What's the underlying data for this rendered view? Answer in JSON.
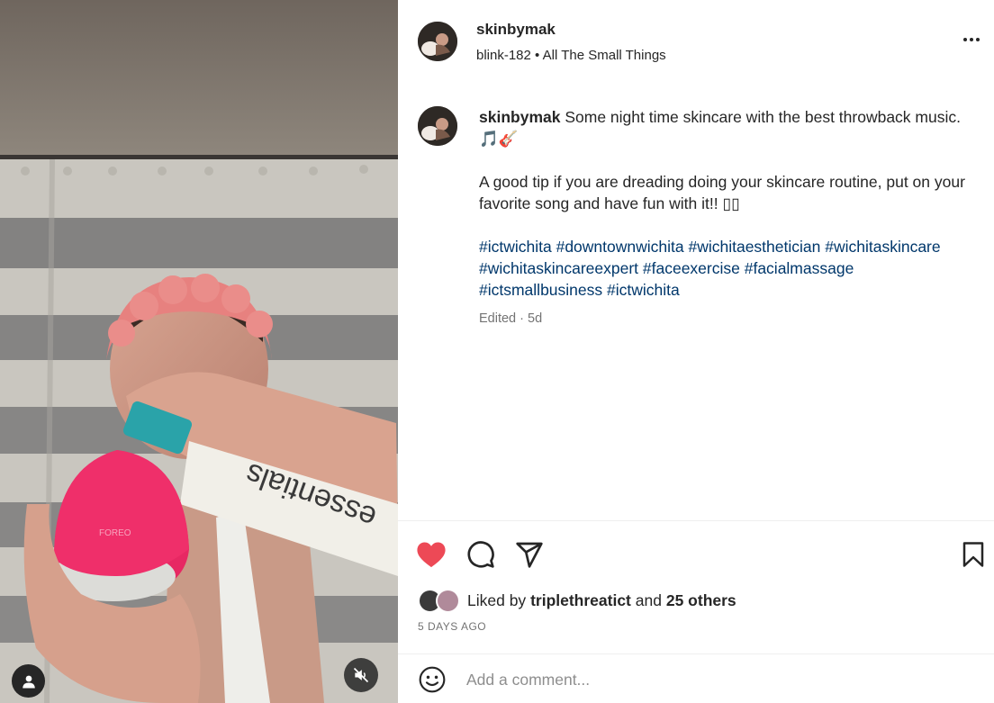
{
  "post": {
    "username": "skinbymak",
    "audio": {
      "artist": "blink-182",
      "separator": "•",
      "track": "All The Small Things"
    }
  },
  "caption": {
    "username": "skinbymak",
    "text": "Some night time skincare with the best throwback music. 🎵🎸",
    "tip": "A good tip if you are dreading doing your skincare routine, put on your favorite song and have fun with it!! ▯▯",
    "hashtags": "#ictwichita #downtownwichita #wichitaesthetician #wichitaskincare #wichitaskincareexpert #faceexercise #facialmassage #ictsmallbusiness #ictwichita",
    "meta": "Edited · 5d"
  },
  "likes": {
    "prefix": "Liked by",
    "user": "triplethreatict",
    "middle": "and",
    "others": "25 others"
  },
  "date": "5 DAYS AGO",
  "comment": {
    "placeholder": "Add a comment..."
  },
  "media": {
    "product_text": "essentials"
  },
  "icons": {
    "like": "heart-filled-icon",
    "comment": "comment-bubble-icon",
    "share": "paper-plane-icon",
    "save": "bookmark-icon",
    "more": "more-options-icon",
    "emoji": "emoji-face-icon",
    "mute": "speaker-muted-icon",
    "tag": "user-tag-icon"
  },
  "colors": {
    "like": "#ed4956",
    "link": "#00376b",
    "muted_text": "#737373"
  }
}
